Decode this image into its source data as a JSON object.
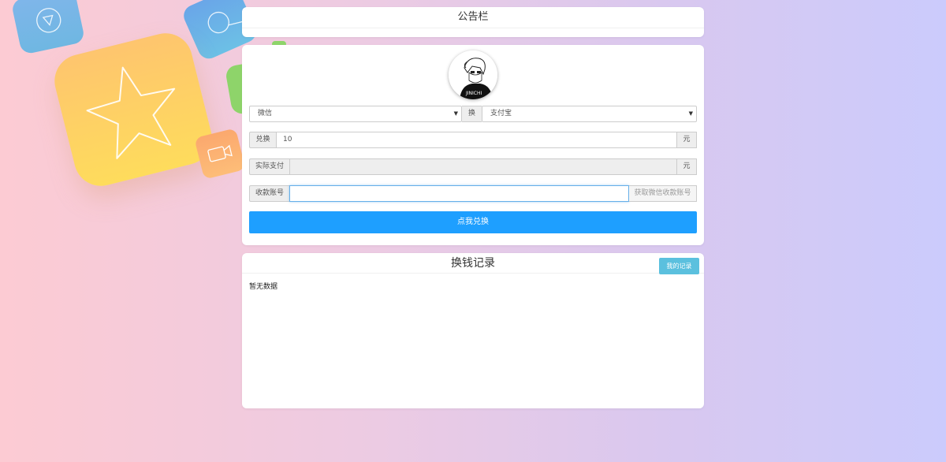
{
  "notice": {
    "title": "公告栏"
  },
  "form": {
    "from_select": "微信",
    "swap_label": "换",
    "to_select": "支付宝",
    "exchange_label": "兑换",
    "exchange_value": "10",
    "unit": "元",
    "actual_label": "实际支付",
    "actual_value": "",
    "actual_unit": "元",
    "account_label": "收款账号",
    "account_value": "",
    "get_account_label": "获取微信收款账号",
    "submit_label": "点我兑换"
  },
  "records": {
    "title": "换钱记录",
    "mine_button": "我的记录",
    "empty_text": "暂无数据"
  },
  "colors": {
    "primary": "#1e9fff",
    "info": "#5bc0de",
    "star_card": "#fec56e"
  },
  "icons": [
    "play-triangle-icon",
    "search-icon",
    "star-icon",
    "video-camera-icon",
    "avatar-image"
  ]
}
